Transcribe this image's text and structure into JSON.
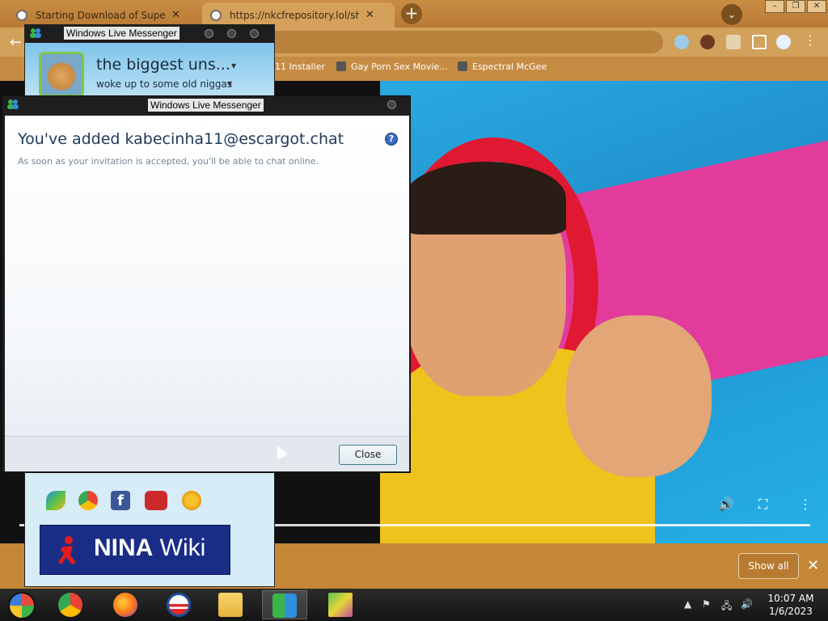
{
  "browser": {
    "tabs": [
      {
        "title": "Starting Download of Super Mari",
        "active": false
      },
      {
        "title": "https://nkcfrepository.lol/shit/",
        "active": true
      }
    ],
    "new_tab": "+",
    "bookmarks": [
      {
        "label": "11 Installer"
      },
      {
        "label": "Gay Porn Sex Movie..."
      },
      {
        "label": "Espectral McGee"
      }
    ],
    "download_bar": {
      "show_all": "Show all",
      "close": "✕"
    },
    "theme_color": "#c98d44"
  },
  "messenger_main": {
    "title": "Windows Live Messenger",
    "display_name": "the biggest uns...",
    "personal_message": "woke up to some old niggas",
    "social_icons": [
      "windows-live-icon",
      "chrome-icon",
      "facebook-icon",
      "youtube-icon",
      "sun-icon"
    ],
    "banner": {
      "brand_bold": "NINA",
      "brand_light": " Wiki"
    }
  },
  "messenger_dialog": {
    "title": "Windows Live Messenger",
    "heading": "You've added kabecinha11@escargot.chat",
    "subtext": "As soon as your invitation is accepted, you'll be able to chat online.",
    "help": "?",
    "close_button": "Close"
  },
  "taskbar": {
    "apps": [
      "chrome",
      "firefox",
      "obama",
      "file-explorer",
      "messenger",
      "wing"
    ],
    "active_app": "messenger",
    "clock_time": "10:07 AM",
    "clock_date": "1/6/2023"
  }
}
